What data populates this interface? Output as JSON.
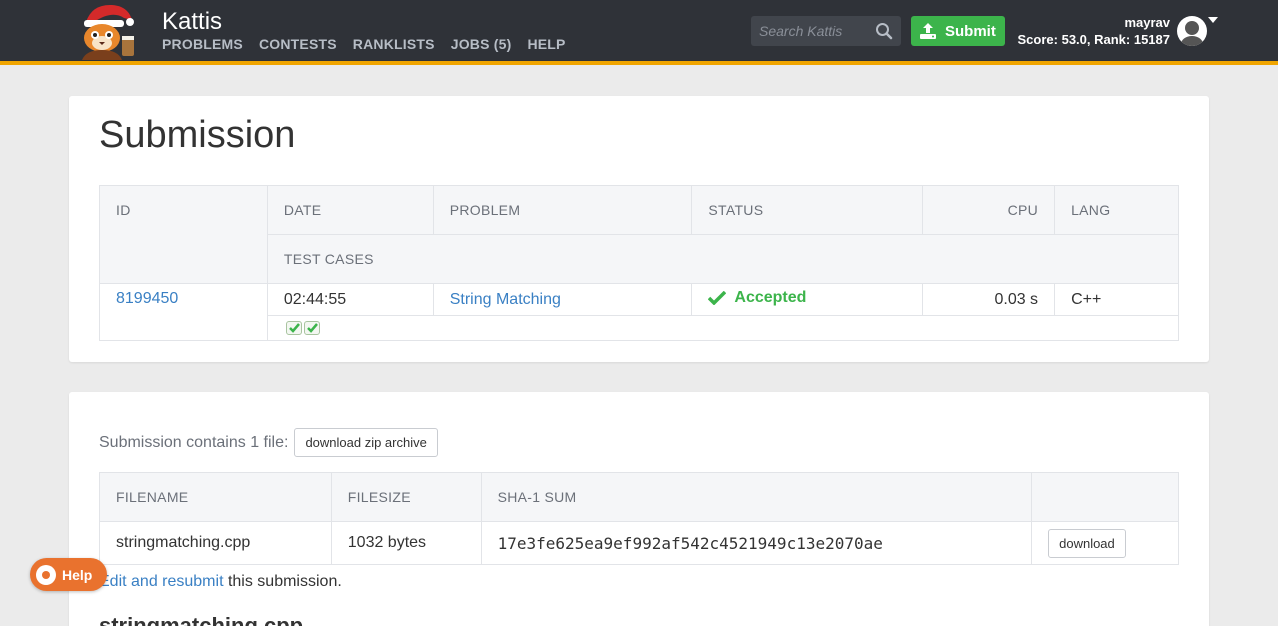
{
  "header": {
    "brand": "Kattis",
    "nav": [
      "PROBLEMS",
      "CONTESTS",
      "RANKLISTS",
      "JOBS (5)",
      "HELP"
    ],
    "search_placeholder": "Search Kattis",
    "submit_label": "Submit",
    "user_name": "mayrav",
    "user_score": "Score: 53.0, Rank: 15187",
    "accent_color": "#f0a500",
    "submit_color": "#3cb44b"
  },
  "submission": {
    "title": "Submission",
    "columns": {
      "id": "ID",
      "date": "DATE",
      "problem": "PROBLEM",
      "status": "STATUS",
      "cpu": "CPU",
      "lang": "LANG",
      "test_cases": "TEST CASES"
    },
    "row": {
      "id": "8199450",
      "date": "02:44:55",
      "problem": "String Matching",
      "status": "Accepted",
      "cpu": "0.03 s",
      "lang": "C++",
      "test_cases_passed": 2
    }
  },
  "files": {
    "contains_text": "Submission contains 1 file:",
    "zip_button": "download zip archive",
    "columns": {
      "filename": "FILENAME",
      "filesize": "FILESIZE",
      "sha": "SHA-1 SUM"
    },
    "rows": [
      {
        "filename": "stringmatching.cpp",
        "filesize": "1032 bytes",
        "sha": "17e3fe625ea9ef992af542c4521949c13e2070ae",
        "download_label": "download"
      }
    ],
    "resubmit_link": "Edit and resubmit",
    "resubmit_rest": " this submission.",
    "code_heading": "stringmatching.cpp"
  },
  "help_button": "Help"
}
